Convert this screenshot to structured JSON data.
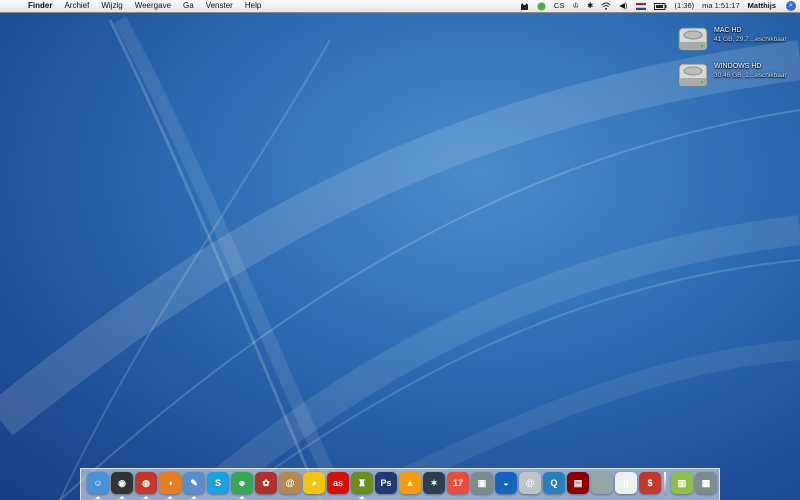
{
  "menubar": {
    "app": "Finder",
    "menus": [
      "Archief",
      "Wijzig",
      "Weergave",
      "Ga",
      "Venster",
      "Help"
    ],
    "status_cs": "CS",
    "battery_time": "(1:36)",
    "clock": "ma 1:51:17",
    "user": "Matthijs"
  },
  "desktop": {
    "disks": [
      {
        "name": "MAC HD",
        "info": "41 GB, 29,7…eschikbaar"
      },
      {
        "name": "WINDOWS HD",
        "info": "30,46 GB, 1…eschikbaar"
      }
    ]
  },
  "dock": {
    "apps": [
      {
        "name": "finder",
        "glyph": "☺",
        "color": "#4a90d9",
        "running": true
      },
      {
        "name": "dashboard",
        "glyph": "◉",
        "color": "#333333",
        "running": true
      },
      {
        "name": "front-row",
        "glyph": "◍",
        "color": "#c0392b",
        "running": true
      },
      {
        "name": "firefox",
        "glyph": "◑",
        "color": "#e67e22",
        "running": true
      },
      {
        "name": "text-editor",
        "glyph": "✎",
        "color": "#5d8dc9",
        "running": true
      },
      {
        "name": "skype",
        "glyph": "S",
        "color": "#1ba1e2",
        "running": false
      },
      {
        "name": "adium",
        "glyph": "☻",
        "color": "#3aa655",
        "running": true
      },
      {
        "name": "ical-red",
        "glyph": "✿",
        "color": "#b0302a",
        "running": false
      },
      {
        "name": "address-book",
        "glyph": "@",
        "color": "#b5884f",
        "running": false
      },
      {
        "name": "cyberduck",
        "glyph": "◕",
        "color": "#f1c40f",
        "running": false
      },
      {
        "name": "lastfm",
        "glyph": "as",
        "color": "#d51007",
        "running": false
      },
      {
        "name": "game",
        "glyph": "♜",
        "color": "#6b8e23",
        "running": true
      },
      {
        "name": "photoshop",
        "glyph": "Ps",
        "color": "#1f3b73",
        "running": false
      },
      {
        "name": "vlc",
        "glyph": "▲",
        "color": "#f39c12",
        "running": false
      },
      {
        "name": "imovie",
        "glyph": "✶",
        "color": "#2c3e50",
        "running": false
      },
      {
        "name": "ical",
        "glyph": "17",
        "color": "#e74c3c",
        "running": false
      },
      {
        "name": "iphoto",
        "glyph": "▣",
        "color": "#7f8c8d",
        "running": false
      },
      {
        "name": "google-earth",
        "glyph": "◒",
        "color": "#1565c0",
        "running": false
      },
      {
        "name": "address",
        "glyph": "@",
        "color": "#bdc3c7",
        "running": false
      },
      {
        "name": "quicktime",
        "glyph": "Q",
        "color": "#2980b9",
        "running": false
      },
      {
        "name": "photo-booth",
        "glyph": "▤",
        "color": "#8b0000",
        "running": false
      },
      {
        "name": "system-preferences",
        "glyph": "",
        "color": "#95a5a6",
        "running": false
      },
      {
        "name": "ipod",
        "glyph": "▯",
        "color": "#ecf0f1",
        "running": false
      },
      {
        "name": "money",
        "glyph": "$",
        "color": "#c0392b",
        "running": false
      },
      {
        "name": "documents",
        "glyph": "▥",
        "color": "#8fbf4a",
        "running": false
      },
      {
        "name": "trash",
        "glyph": "▦",
        "color": "#7f8c8d",
        "running": false
      }
    ]
  }
}
